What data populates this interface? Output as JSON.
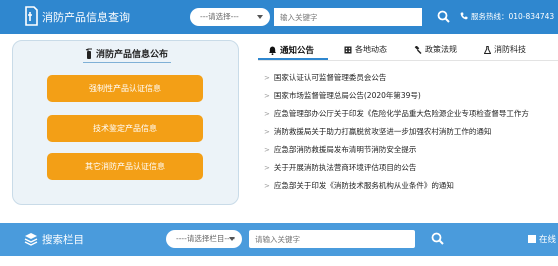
{
  "header": {
    "title": "消防产品信息查询",
    "category_select": "---请选择---",
    "search_placeholder": "输入关键字",
    "hotline": "服务热线：010-834743"
  },
  "left_panel": {
    "title": "消防产品信息公布",
    "buttons": [
      "强制性产品认证信息",
      "技术鉴定产品信息",
      "其它消防产品认证信息"
    ]
  },
  "tabs": [
    {
      "label": "通知公告",
      "icon": "bell-icon",
      "active": true
    },
    {
      "label": "各地动态",
      "icon": "building-icon",
      "active": false
    },
    {
      "label": "政策法规",
      "icon": "gavel-icon",
      "active": false
    },
    {
      "label": "消防科技",
      "icon": "flask-icon",
      "active": false
    }
  ],
  "news": [
    "国家认证认可监督管理委员会公告",
    "国家市场监督管理总局公告(2020年第39号)",
    "应急管理部办公厅关于印发《危险化学品重大危险源企业专项检查督导工作方",
    "消防救援局关于助力打赢脱贫攻坚进一步加强农村消防工作的通知",
    "应急部消防救援局发布清明节消防安全提示",
    "关于开展消防执法营商环境评估项目的公告",
    "应急部关于印发《消防技术服务机构从业条件》的通知"
  ],
  "search_bar": {
    "title": "搜索栏目",
    "column_select": "----请选择栏目----",
    "keyword_placeholder": "请输入关键字",
    "right_label": "在线"
  },
  "colors": {
    "header_blue": "#2f87cf",
    "bottom_blue": "#4a9bdc",
    "button_orange": "#f39f16",
    "panel_bg": "#ecf3f8"
  }
}
